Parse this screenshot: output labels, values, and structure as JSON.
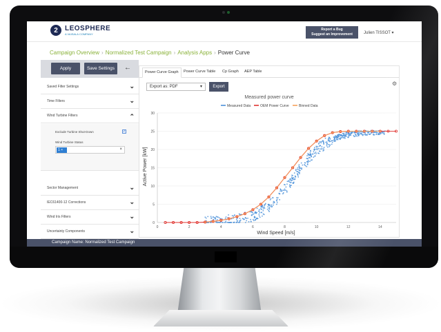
{
  "brand": {
    "name": "LEOSPHERE",
    "sub": "A VAISALA COMPANY",
    "mark": "2"
  },
  "header": {
    "report_line1": "Report a Bug",
    "report_line2": "Suggest an Improvement",
    "user": "Julien TISSOT ▾"
  },
  "breadcrumb": [
    "Campaign Overview",
    "Normalized Test Campaign",
    "Analysis Apps",
    "Power Curve"
  ],
  "sidebar": {
    "apply": "Apply",
    "save": "Save Settings",
    "items": [
      {
        "label": "Saved Filter Settings"
      },
      {
        "label": "Time Filters"
      },
      {
        "label": "Wind Turbine Filters"
      },
      {
        "label": "Sector Management"
      },
      {
        "label": "IEC61400-12 Corrections"
      },
      {
        "label": "Wind Iris Filters"
      },
      {
        "label": "Uncertainty Components"
      }
    ],
    "wt_sub": {
      "shutdown": "Exclude Turbine Shut-Down",
      "status_label": "Wind Turbine Status",
      "status_tag": "1 ×",
      "clear": "×"
    }
  },
  "footer": "Campaign Name: Normalized Test Campaign",
  "tabs": [
    "Power Curve Graph",
    "Power Curve Table",
    "Cp Graph",
    "AEP Table"
  ],
  "export": {
    "select": "Export as: PDF",
    "button": "Export"
  },
  "chart_data": {
    "type": "scatter",
    "title": "Measured power curve",
    "xlabel": "Wind Speed [m/s]",
    "ylabel": "Active Power [kW]",
    "xlim": [
      0,
      15
    ],
    "ylim": [
      0,
      30
    ],
    "xticks": [
      0,
      2,
      4,
      6,
      8,
      10,
      12,
      14
    ],
    "yticks": [
      0,
      5,
      10,
      15,
      20,
      25,
      30
    ],
    "legend": [
      "Measured Data",
      "OEM Power Curve",
      "Binned Data"
    ],
    "colors": {
      "measured": "#4a90d9",
      "oem": "#e0332f",
      "binned": "#f5a05a"
    },
    "oem": {
      "x": [
        0.5,
        1,
        1.5,
        2,
        2.5,
        3,
        3.5,
        4,
        4.5,
        5,
        5.5,
        6,
        6.5,
        7,
        7.5,
        8,
        8.5,
        9,
        9.5,
        10,
        10.5,
        11,
        11.5,
        12,
        12.5,
        13,
        13.5,
        14,
        14.5,
        15
      ],
      "y": [
        0,
        0,
        0,
        0,
        0,
        0.1,
        0.3,
        0.6,
        1.0,
        1.6,
        2.4,
        3.5,
        5.0,
        7.0,
        9.5,
        12.3,
        15.0,
        17.8,
        20.3,
        22.3,
        23.8,
        24.6,
        24.9,
        25,
        25,
        25,
        25,
        25,
        25,
        25
      ]
    },
    "binned": {
      "x": [
        3,
        3.5,
        4,
        4.5,
        5,
        5.5,
        6,
        6.5,
        7,
        7.5,
        8,
        8.5,
        9,
        9.5,
        10,
        10.5,
        11,
        11.5,
        12,
        12.5,
        13,
        13.5,
        14
      ],
      "y": [
        0.1,
        0.3,
        0.6,
        1.0,
        1.6,
        2.4,
        3.5,
        5.0,
        7.0,
        9.5,
        12.3,
        15.0,
        17.8,
        20.3,
        22.3,
        23.8,
        24.6,
        24.9,
        25,
        25,
        25,
        25,
        25
      ]
    }
  }
}
